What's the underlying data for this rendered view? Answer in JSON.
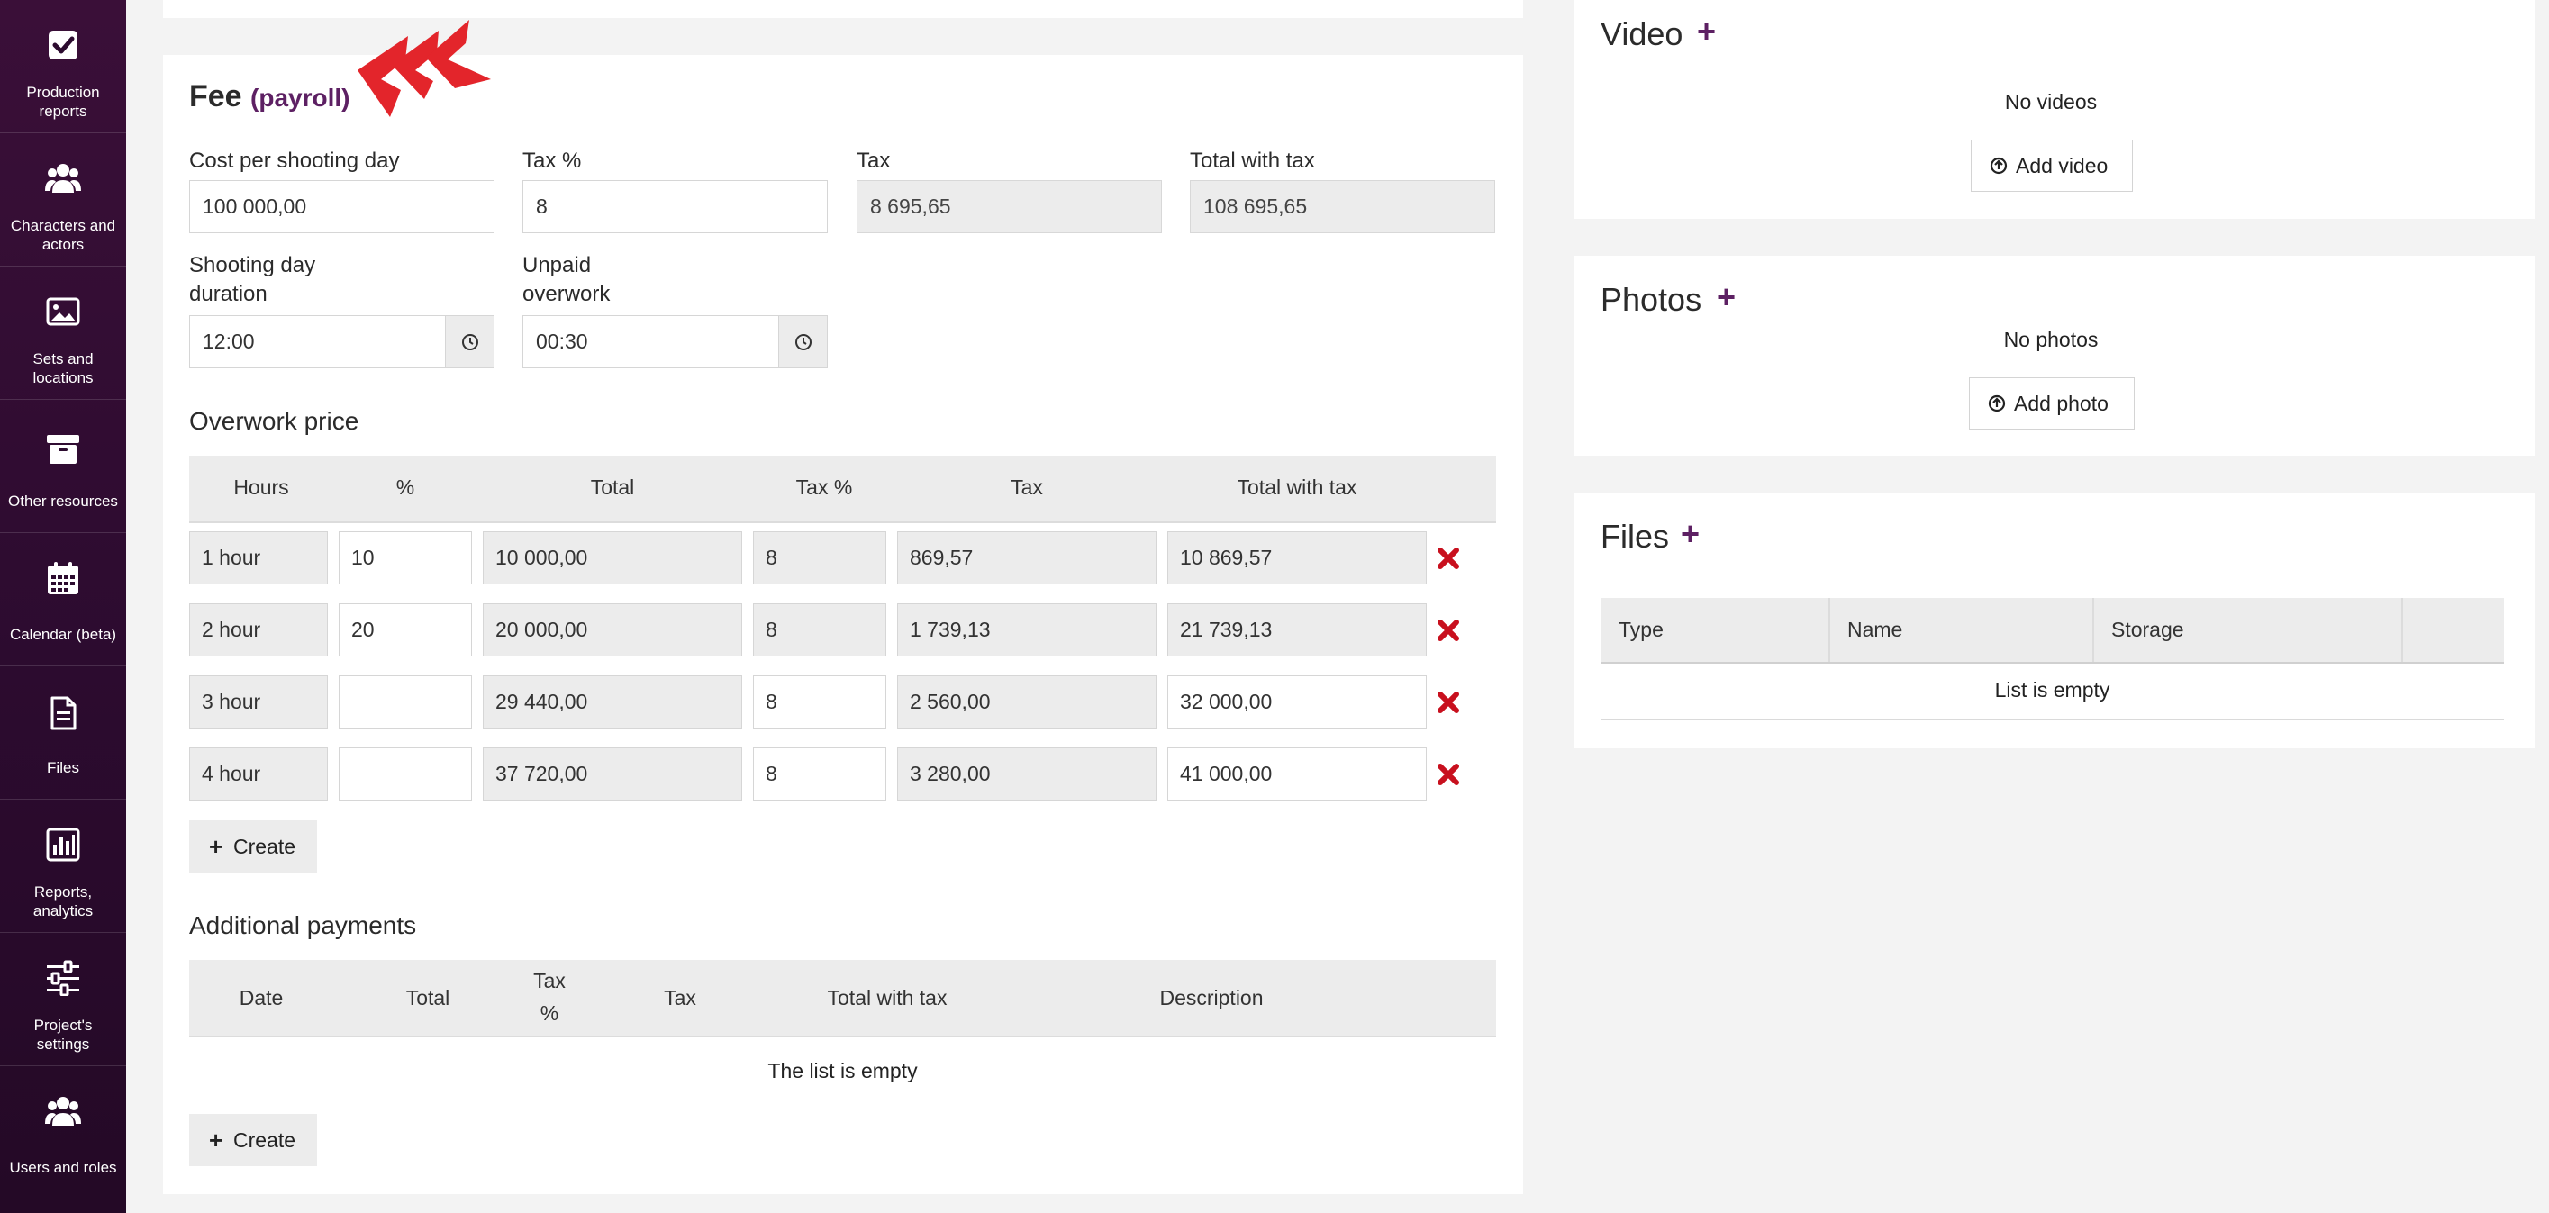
{
  "sidebar": {
    "items": [
      {
        "label_l1": "Production",
        "label_l2": "reports",
        "icon": "checkbox-icon"
      },
      {
        "label_l1": "Characters and",
        "label_l2": "actors",
        "icon": "users-icon"
      },
      {
        "label_l1": "Sets and",
        "label_l2": "locations",
        "icon": "image-icon"
      },
      {
        "label_l1": "Other resources",
        "label_l2": "",
        "icon": "archive-icon"
      },
      {
        "label_l1": "Calendar (beta)",
        "label_l2": "",
        "icon": "calendar-icon"
      },
      {
        "label_l1": "Files",
        "label_l2": "",
        "icon": "file-icon"
      },
      {
        "label_l1": "Reports,",
        "label_l2": "analytics",
        "icon": "bar-chart-icon"
      },
      {
        "label_l1": "Project's",
        "label_l2": "settings",
        "icon": "sliders-icon"
      },
      {
        "label_l1": "Users and roles",
        "label_l2": "",
        "icon": "users-icon"
      }
    ]
  },
  "fee": {
    "title": "Fee",
    "subtitle": "(payroll)",
    "cost_label": "Cost per shooting day",
    "cost_value": "100 000,00",
    "tax_pct_label": "Tax %",
    "tax_pct_value": "8",
    "tax_label": "Tax",
    "tax_value": "8 695,65",
    "total_label": "Total with tax",
    "total_value": "108 695,65",
    "duration_label_l1": "Shooting day",
    "duration_label_l2": "duration",
    "duration_value": "12:00",
    "unpaid_label_l1": "Unpaid",
    "unpaid_label_l2": "overwork",
    "unpaid_value": "00:30"
  },
  "overwork": {
    "title": "Overwork price",
    "columns": [
      "Hours",
      "%",
      "Total",
      "Tax %",
      "Tax",
      "Total with tax"
    ],
    "rows": [
      {
        "hours": "1 hour",
        "pct": "10",
        "total": "10 000,00",
        "tax_pct": "8",
        "tax": "869,57",
        "total_tax": "10 869,57"
      },
      {
        "hours": "2 hour",
        "pct": "20",
        "total": "20 000,00",
        "tax_pct": "8",
        "tax": "1 739,13",
        "total_tax": "21 739,13"
      },
      {
        "hours": "3 hour",
        "pct": "",
        "total": "29 440,00",
        "tax_pct": "8",
        "tax": "2 560,00",
        "total_tax": "32 000,00"
      },
      {
        "hours": "4 hour",
        "pct": "",
        "total": "37 720,00",
        "tax_pct": "8",
        "tax": "3 280,00",
        "total_tax": "41 000,00"
      }
    ],
    "create_label": "Create"
  },
  "additional": {
    "title": "Additional payments",
    "columns": [
      "Date",
      "Total",
      "Tax",
      "%",
      "Tax",
      "Total with tax",
      "Description"
    ],
    "empty_text": "The list is empty",
    "create_label": "Create"
  },
  "video": {
    "title": "Video",
    "empty_text": "No videos",
    "button_label": "Add video"
  },
  "photos": {
    "title": "Photos",
    "empty_text": "No photos",
    "button_label": "Add photo"
  },
  "files": {
    "title": "Files",
    "columns": [
      "Type",
      "Name",
      "Storage"
    ],
    "empty_text": "List is empty"
  },
  "colors": {
    "accent": "#5d2063",
    "sidebar": "#2c0b2f",
    "danger": "#c8101e",
    "arrow": "#e3252b"
  }
}
